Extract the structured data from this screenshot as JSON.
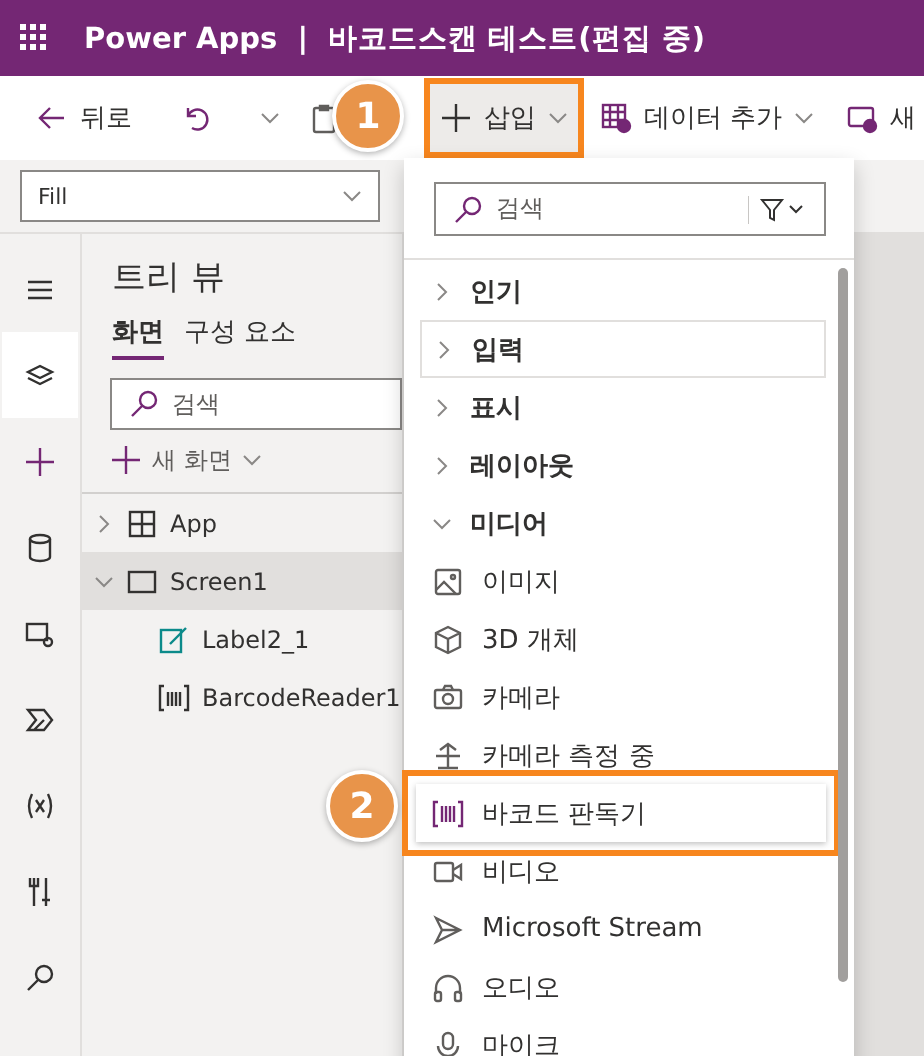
{
  "window": {
    "title": "Power Apps  |  바코드스캔 테스트(편집 중)"
  },
  "toolbar": {
    "back": "뒤로",
    "insert": {
      "label": "삽입",
      "open": true
    },
    "add_data": "데이터 추가",
    "new_screen": "새"
  },
  "formula_bar": {
    "property": "Fill"
  },
  "tree_view": {
    "title": "트리 뷰",
    "tabs": [
      {
        "label": "화면",
        "selected": true
      },
      {
        "label": "구성 요소",
        "selected": false
      }
    ],
    "search": {
      "placeholder": "검색"
    },
    "new_screen": "새 화면",
    "items": [
      {
        "label": "App",
        "kind": "app",
        "expanded": false,
        "selected": false
      },
      {
        "label": "Screen1",
        "kind": "screen",
        "expanded": true,
        "selected": true,
        "children": [
          {
            "label": "Label2_1",
            "kind": "label",
            "selected": false
          },
          {
            "label": "BarcodeReader1",
            "kind": "barcode",
            "selected": false
          }
        ]
      }
    ]
  },
  "insert_menu": {
    "search": {
      "placeholder": "검색"
    },
    "items": [
      {
        "kind": "category",
        "label": "인기",
        "expanded": false,
        "hovered": false
      },
      {
        "kind": "category",
        "label": "입력",
        "expanded": false,
        "hovered": true
      },
      {
        "kind": "category",
        "label": "표시",
        "expanded": false,
        "hovered": false
      },
      {
        "kind": "category",
        "label": "레이아웃",
        "expanded": false,
        "hovered": false
      },
      {
        "kind": "category",
        "label": "미디어",
        "expanded": true,
        "hovered": false
      },
      {
        "kind": "item",
        "label": "이미지",
        "selected": false
      },
      {
        "kind": "item",
        "label": "3D 개체",
        "selected": false
      },
      {
        "kind": "item",
        "label": "카메라",
        "selected": false
      },
      {
        "kind": "item",
        "label": "카메라 측정 중",
        "selected": false
      },
      {
        "kind": "item",
        "label": "바코드 판독기",
        "selected": true
      },
      {
        "kind": "item",
        "label": "비디오",
        "selected": false
      },
      {
        "kind": "item",
        "label": "Microsoft Stream",
        "selected": false
      },
      {
        "kind": "item",
        "label": "오디오",
        "selected": false
      },
      {
        "kind": "item",
        "label": "마이크",
        "selected": false
      }
    ]
  },
  "callouts": [
    {
      "label": "1"
    },
    {
      "label": "2"
    }
  ]
}
